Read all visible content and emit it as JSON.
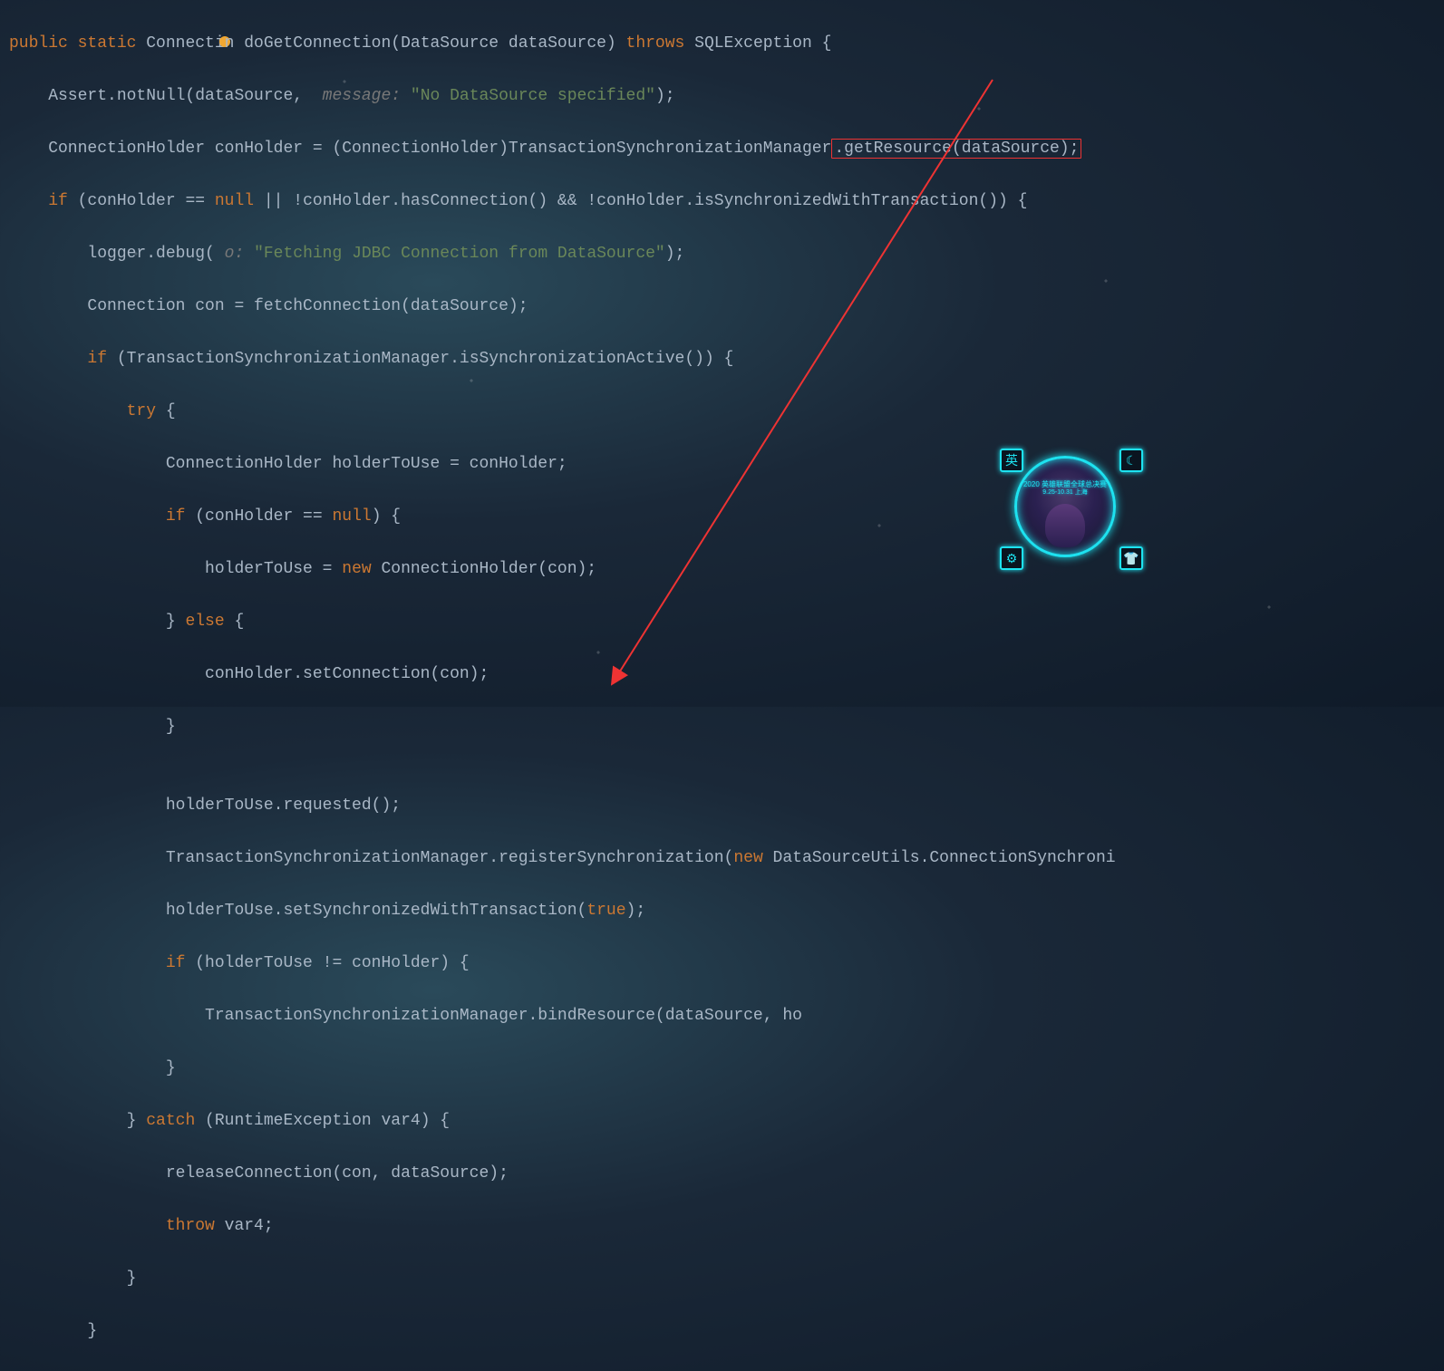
{
  "code": {
    "l1_public": "public",
    "l1_static": "static",
    "l1_rest1": " Connecti",
    "l1_rest1b": "n doGetConnection(DataSource dataSource) ",
    "l1_throws": "throws",
    "l1_rest2": " SQLException {",
    "l2_a": "    Assert.notNull(dataSource, ",
    "l2_hint": " message: ",
    "l2_str": "\"No DataSource specified\"",
    "l2_b": ");",
    "l3_a": "    ConnectionHolder conHolder = (ConnectionHolder)TransactionSynchronizationManager",
    "l3_box": ".getResource(dataSource);",
    "l4_a": "    ",
    "l4_if": "if",
    "l4_b": " (conHolder == ",
    "l4_null": "null",
    "l4_c": " || !conHolder.hasConnection() && !conHolder.isSynchronizedWithTransaction()) {",
    "l5_a": "        logger.debug(",
    "l5_hint": " o: ",
    "l5_str": "\"Fetching JDBC Connection from DataSource\"",
    "l5_b": ");",
    "l6": "        Connection con = fetchConnection(dataSource);",
    "l7_a": "        ",
    "l7_if": "if",
    "l7_b": " (TransactionSynchronizationManager.isSynchronizationActive()) {",
    "l8_a": "            ",
    "l8_try": "try",
    "l8_b": " {",
    "l9": "                ConnectionHolder holderToUse = conHolder;",
    "l10_a": "                ",
    "l10_if": "if",
    "l10_b": " (conHolder == ",
    "l10_null": "null",
    "l10_c": ") {",
    "l11_a": "                    holderToUse = ",
    "l11_new": "new",
    "l11_b": " ConnectionHolder(con);",
    "l12_a": "                } ",
    "l12_else": "else",
    "l12_b": " {",
    "l13": "                    conHolder.setConnection(con);",
    "l14": "                }",
    "l15": "",
    "l16": "                holderToUse.requested();",
    "l17_a": "                TransactionSynchronizationManager.registerSynchronization(",
    "l17_new": "new",
    "l17_b": " DataSourceUtils.ConnectionSynchroni",
    "l18_a": "                holderToUse.setSynchronizedWithTransaction(",
    "l18_true": "true",
    "l18_b": ");",
    "l19_a": "                ",
    "l19_if": "if",
    "l19_b": " (holderToUse != conHolder) {",
    "l20": "                    TransactionSynchronizationManager.bindResource(dataSource, ho",
    "l21": "                }",
    "l22_a": "            } ",
    "l22_catch": "catch",
    "l22_b": " (RuntimeException var4) {",
    "l23": "                releaseConnection(con, dataSource);",
    "l24_a": "                ",
    "l24_throw": "throw",
    "l24_b": " var4;",
    "l25": "            }",
    "l26": "        }"
  },
  "widget": {
    "title": "2020 英雄联盟全球总决赛",
    "subtitle": "9.25-10.31 上海",
    "btn_tl": "英",
    "btn_tr": "☾",
    "btn_bl": "⚙",
    "btn_br": "👕"
  }
}
